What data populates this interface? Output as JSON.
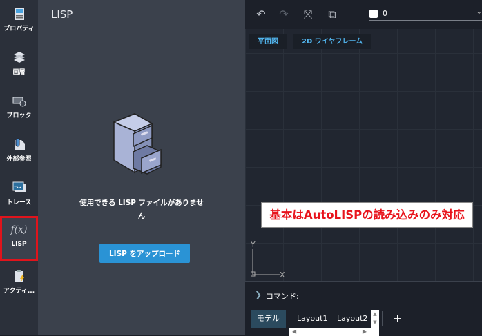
{
  "sidebar": {
    "items": [
      {
        "label": "プロパティ",
        "icon": "properties-icon"
      },
      {
        "label": "画層",
        "icon": "layers-icon"
      },
      {
        "label": "ブロック",
        "icon": "block-icon"
      },
      {
        "label": "外部参照",
        "icon": "xref-icon"
      },
      {
        "label": "トレース",
        "icon": "trace-icon"
      },
      {
        "label": "LISP",
        "icon": "function-icon",
        "glyph": "f(x)",
        "active": true
      },
      {
        "label": "アクティ...",
        "icon": "activity-icon"
      }
    ]
  },
  "panel": {
    "title": "LISP",
    "empty_message": "使用できる LISP ファイルがありません",
    "upload_label": "LISP をアップロード"
  },
  "toolbar": {
    "layer_value": "0",
    "layer_color": "#ffffff"
  },
  "view": {
    "view_label": "平面図",
    "style_label": "2D ワイヤフレーム",
    "ucs_x": "X",
    "ucs_y": "Y"
  },
  "command": {
    "label": "コマンド:"
  },
  "tabs": [
    {
      "label": "モデル",
      "active": true
    },
    {
      "label": "Layout1"
    },
    {
      "label": "Layout2"
    }
  ],
  "add_tab": "+",
  "annotation": {
    "text": "基本はAutoLISPの読み込みのみ対応",
    "color": "#e8131c"
  }
}
